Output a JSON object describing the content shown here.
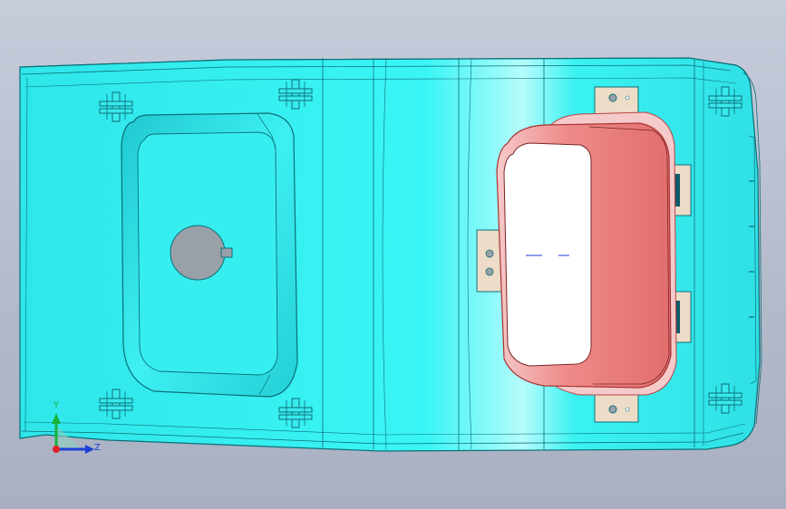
{
  "viewport": {
    "background_top": "#c6ccda",
    "background_bottom": "#a9b0c1"
  },
  "model": {
    "body_color": "#38f2f2",
    "body_shade": "#20c9cf",
    "edge_color": "#0b6f77",
    "hole_color": "#9aa0a8",
    "part_color": "#ea7474",
    "part_highlight": "#ffffff"
  },
  "triad": {
    "y_label": "Y",
    "z_label": "Z",
    "y_color": "#17b33a",
    "z_color": "#1b3fd6",
    "origin_color": "#e0202a"
  }
}
